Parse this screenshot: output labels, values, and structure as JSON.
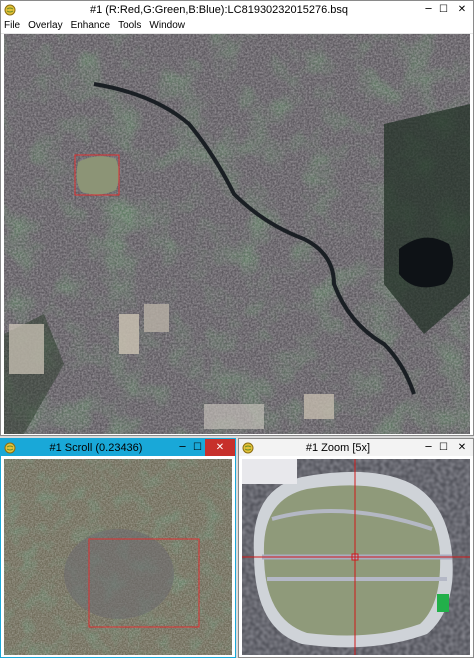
{
  "main_window": {
    "title": "#1 (R:Red,G:Green,B:Blue):LC81930232015276.bsq",
    "menu": [
      "File",
      "Overlay",
      "Enhance",
      "Tools",
      "Window"
    ],
    "controls": {
      "minimize": "─",
      "maximize": "☐",
      "close": "✕"
    }
  },
  "scroll_window": {
    "title": "#1 Scroll (0.23436)",
    "controls": {
      "minimize": "─",
      "maximize": "☐",
      "close": "✕"
    }
  },
  "zoom_window": {
    "title": "#1 Zoom [5x]",
    "controls": {
      "minimize": "─",
      "maximize": "☐",
      "close": "✕"
    }
  },
  "icons": {
    "app": "envi-globe-icon",
    "minimize": "minimize-icon",
    "maximize": "maximize-icon",
    "close": "close-icon"
  },
  "colors": {
    "scroll_titlebar": "#19a8d8",
    "close_button": "#c7302b",
    "selection_box": "#e03030",
    "crosshair": "#d01818"
  }
}
